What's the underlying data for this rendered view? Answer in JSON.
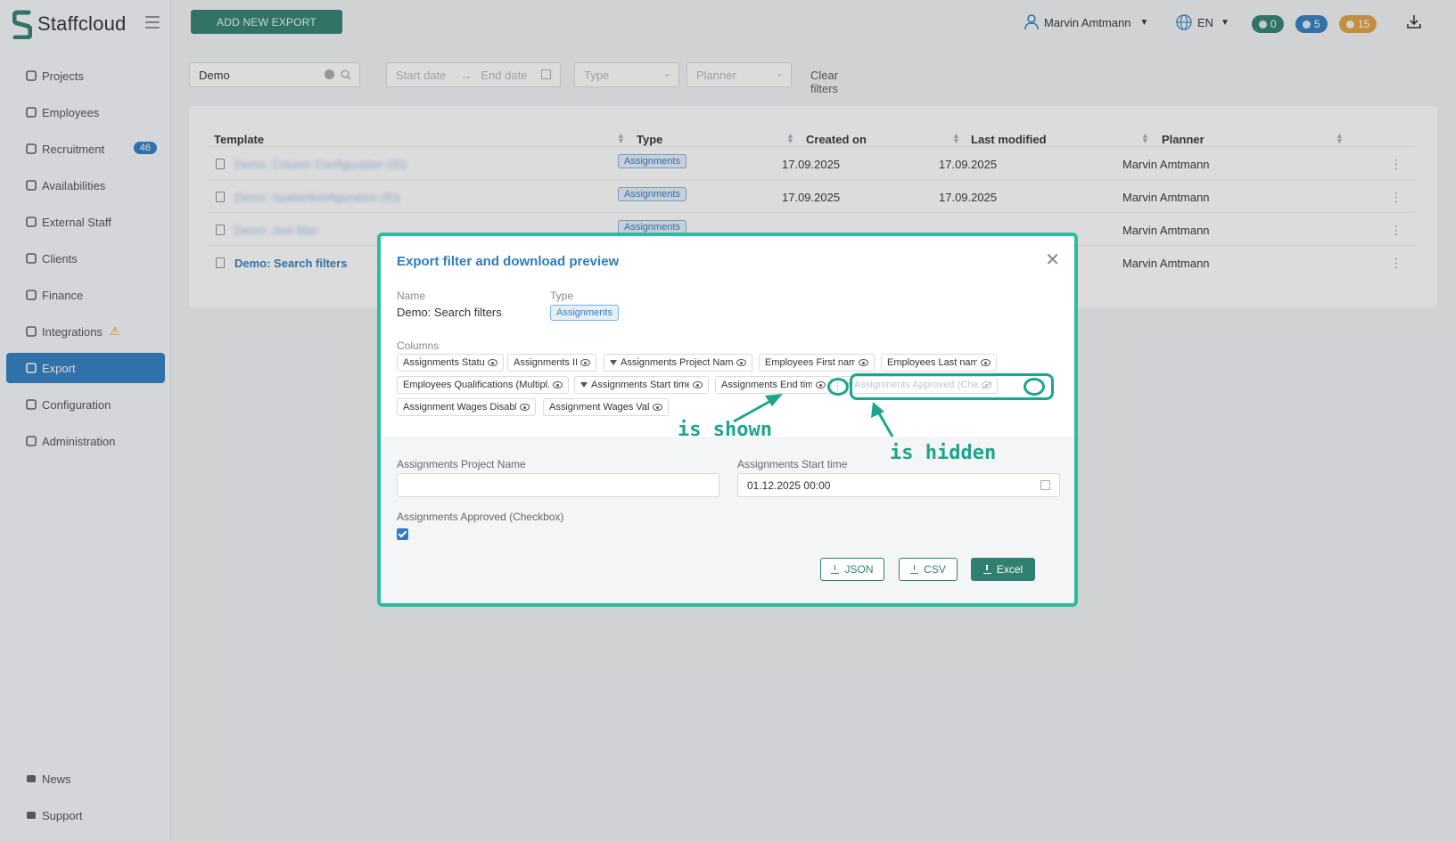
{
  "brand": {
    "name": "Staffcloud",
    "accent": "#2f7dc0",
    "green": "#2f8070",
    "annotation": "#1fa58e"
  },
  "topbar": {
    "add_button": "ADD NEW EXPORT",
    "user_name": "Marvin Amtmann",
    "language": "EN",
    "counters": [
      {
        "name": "messages",
        "value": "0",
        "color": "#2f8070"
      },
      {
        "name": "notifications",
        "value": "5",
        "color": "#2f7dc0"
      },
      {
        "name": "alerts",
        "value": "15",
        "color": "#e0a040"
      }
    ]
  },
  "sidebar": {
    "items": [
      {
        "label": "Projects",
        "icon": "sitemap-icon"
      },
      {
        "label": "Employees",
        "icon": "users-icon"
      },
      {
        "label": "Recruitment",
        "icon": "user-plus-icon",
        "badge": "46"
      },
      {
        "label": "Availabilities",
        "icon": "calendar-icon"
      },
      {
        "label": "External Staff",
        "icon": "sign-in-icon"
      },
      {
        "label": "Clients",
        "icon": "building-icon"
      },
      {
        "label": "Finance",
        "icon": "money-icon"
      },
      {
        "label": "Integrations",
        "icon": "sync-icon",
        "warning": "⚠"
      },
      {
        "label": "Export",
        "icon": "file-icon",
        "active": true
      },
      {
        "label": "Configuration",
        "icon": "gear-icon"
      },
      {
        "label": "Administration",
        "icon": "user-cog-icon"
      }
    ],
    "bottom": [
      {
        "label": "News",
        "icon": "megaphone-icon"
      },
      {
        "label": "Support",
        "icon": "chat-icon"
      }
    ]
  },
  "filters": {
    "search_value": "Demo",
    "start_placeholder": "Start date",
    "end_placeholder": "End date",
    "type_placeholder": "Type",
    "planner_placeholder": "Planner",
    "clear": "Clear filters"
  },
  "table": {
    "headers": [
      "Template",
      "Type",
      "Created on",
      "Last modified",
      "Planner"
    ],
    "rows": [
      {
        "template": "Demo: Column Configuration (ID)",
        "type": "Assignments",
        "created": "17.09.2025",
        "modified": "17.09.2025",
        "planner": "Marvin Amtmann",
        "blurred": true
      },
      {
        "template": "Demo: Spaltenkonfiguration (ID)",
        "type": "Assignments",
        "created": "17.09.2025",
        "modified": "17.09.2025",
        "planner": "Marvin Amtmann",
        "blurred": true
      },
      {
        "template": "Demo: Just filter",
        "type": "Assignments",
        "created": "",
        "modified": "",
        "planner": "Marvin Amtmann",
        "blurred": true
      },
      {
        "template": "Demo: Search filters",
        "type": "",
        "created": "",
        "modified": "",
        "planner": "Marvin Amtmann",
        "blurred": false
      }
    ]
  },
  "modal": {
    "title": "Export filter and download preview",
    "name_label": "Name",
    "name_value": "Demo: Search filters",
    "type_label": "Type",
    "type_value": "Assignments",
    "columns_label": "Columns",
    "columns": [
      {
        "label": "Assignments Status",
        "filter": false,
        "visible": true
      },
      {
        "label": "Assignments ID",
        "filter": false,
        "visible": true
      },
      {
        "label": "Assignments Project Name",
        "filter": true,
        "visible": true
      },
      {
        "label": "Employees First name",
        "filter": false,
        "visible": true
      },
      {
        "label": "Employees Last name",
        "filter": false,
        "visible": true
      },
      {
        "label": "Employees Qualifications (Multipl...",
        "filter": false,
        "visible": true
      },
      {
        "label": "Assignments Start time",
        "filter": true,
        "visible": true
      },
      {
        "label": "Assignments End time",
        "filter": false,
        "visible": true
      },
      {
        "label": "Assignments Approved (Checkbox",
        "filter": true,
        "visible": false
      },
      {
        "label": "Assignment Wages Disabled",
        "filter": false,
        "visible": true
      },
      {
        "label": "Assignment Wages Valid",
        "filter": false,
        "visible": true
      }
    ],
    "field_project_label": "Assignments Project Name",
    "field_project_value": "",
    "field_start_label": "Assignments Start time",
    "field_start_value": "01.12.2025 00:00",
    "field_approved_label": "Assignments Approved (Checkbox)",
    "field_approved_checked": true,
    "buttons": {
      "json": "JSON",
      "csv": "CSV",
      "excel": "Excel"
    }
  },
  "annotations": {
    "shown": "is shown",
    "hidden": "is hidden"
  }
}
